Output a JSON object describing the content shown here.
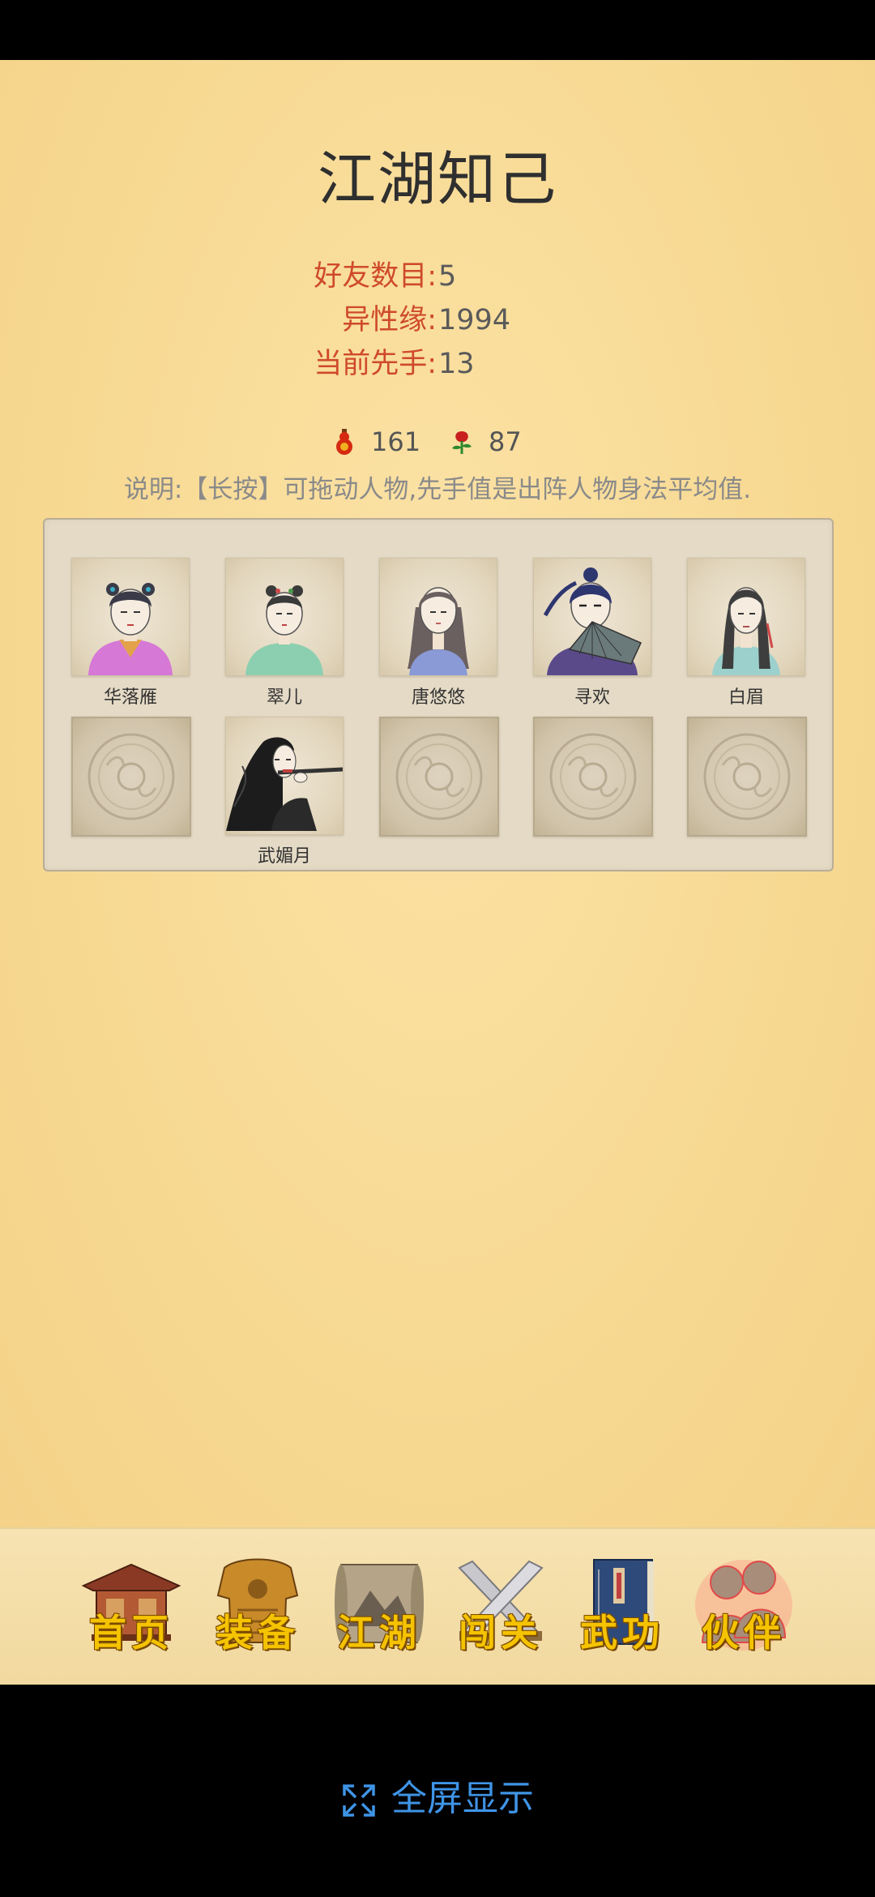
{
  "page": {
    "title": "江湖知己"
  },
  "stats": [
    {
      "label": "好友数目:",
      "value": "5"
    },
    {
      "label": "异性缘:",
      "value": "1994"
    },
    {
      "label": "当前先手:",
      "value": "13"
    }
  ],
  "resources": [
    {
      "icon": "red-gourd-icon",
      "value": "161"
    },
    {
      "icon": "rose-icon",
      "value": "87"
    }
  ],
  "note": "说明:【长按】可拖动人物,先手值是出阵人物身法平均值.",
  "party": [
    {
      "name": "华落雁",
      "portrait": "woman-pink-dress-portrait"
    },
    {
      "name": "翠儿",
      "portrait": "girl-green-dress-portrait"
    },
    {
      "name": "唐悠悠",
      "portrait": "woman-long-hair-portrait"
    },
    {
      "name": "寻欢",
      "portrait": "man-with-fan-portrait"
    },
    {
      "name": "白眉",
      "portrait": "woman-teal-robe-portrait"
    },
    {
      "name": "",
      "portrait": "empty-slot"
    },
    {
      "name": "武媚月",
      "portrait": "woman-playing-flute-portrait"
    },
    {
      "name": "",
      "portrait": "empty-slot"
    },
    {
      "name": "",
      "portrait": "empty-slot"
    },
    {
      "name": "",
      "portrait": "empty-slot"
    }
  ],
  "nav": [
    {
      "label": "首页",
      "icon": "temple-icon",
      "active": false
    },
    {
      "label": "装备",
      "icon": "armor-icon",
      "active": false
    },
    {
      "label": "江湖",
      "icon": "scroll-icon",
      "active": false
    },
    {
      "label": "闯关",
      "icon": "crossed-swords-icon",
      "active": false
    },
    {
      "label": "武功",
      "icon": "book-icon",
      "active": false
    },
    {
      "label": "伙伴",
      "icon": "partners-icon",
      "active": true
    }
  ],
  "fullscreen": {
    "label": "全屏显示",
    "icon": "expand-icon"
  },
  "colors": {
    "label_red": "#cf4a2c",
    "nav_gold": "#f5c300",
    "link_blue": "#3f94e6"
  }
}
